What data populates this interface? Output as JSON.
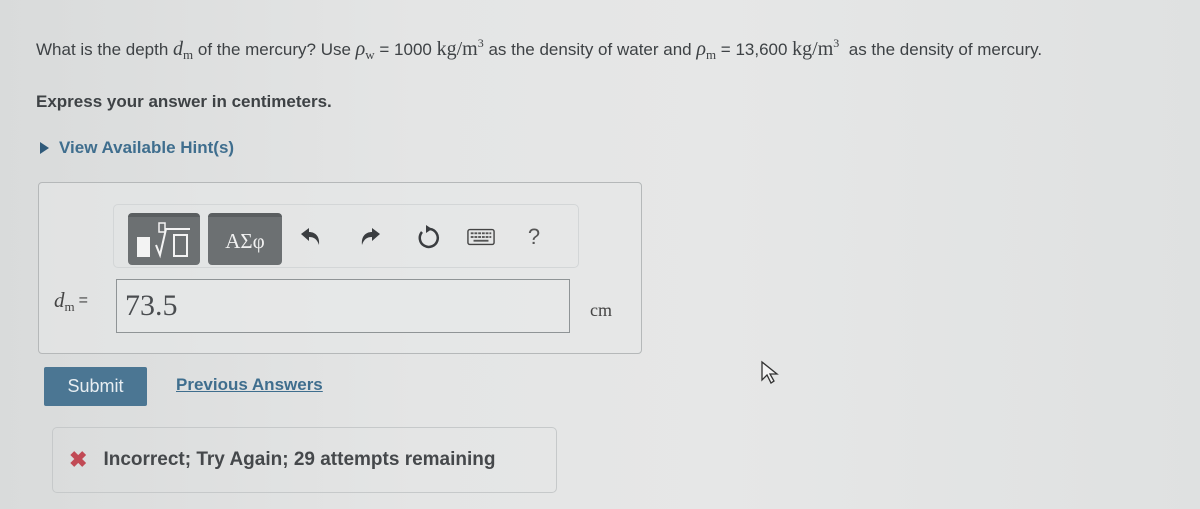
{
  "question": {
    "part1": "What is the depth ",
    "var_d": "d",
    "var_d_sub": "m",
    "part2": " of the mercury? Use ",
    "rho": "ρ",
    "rho_w_sub": "w",
    "rho_w_value": " = 1000 ",
    "unit_kg": "kg/m",
    "unit_exp": "3",
    "part3": " as the density of water and ",
    "rho_m_sub": "m",
    "rho_m_value": " = 13,600 ",
    "part4": " as the density of mercury."
  },
  "instruction": "Express your answer in centimeters.",
  "hint_link": "View Available Hint(s)",
  "toolbar": {
    "templates_icon": "templates-icon",
    "greek_label": "ΑΣφ",
    "undo_icon": "undo-icon",
    "redo_icon": "redo-icon",
    "reset_icon": "reset-icon",
    "keyboard_icon": "keyboard-icon",
    "help_label": "?"
  },
  "answer": {
    "label_var": "d",
    "label_sub": "m",
    "label_eq": "=",
    "value": "73.5",
    "unit": "cm"
  },
  "actions": {
    "submit_label": "Submit",
    "previous_answers_label": "Previous Answers"
  },
  "feedback": {
    "icon": "x-icon",
    "icon_glyph": "✖",
    "message": "Incorrect; Try Again; 29 attempts remaining",
    "color": "#c14a55"
  },
  "colors": {
    "link": "#3f6e8e",
    "submit_bg": "#4b7693",
    "toolbar_button_bg": "#6c7072"
  }
}
